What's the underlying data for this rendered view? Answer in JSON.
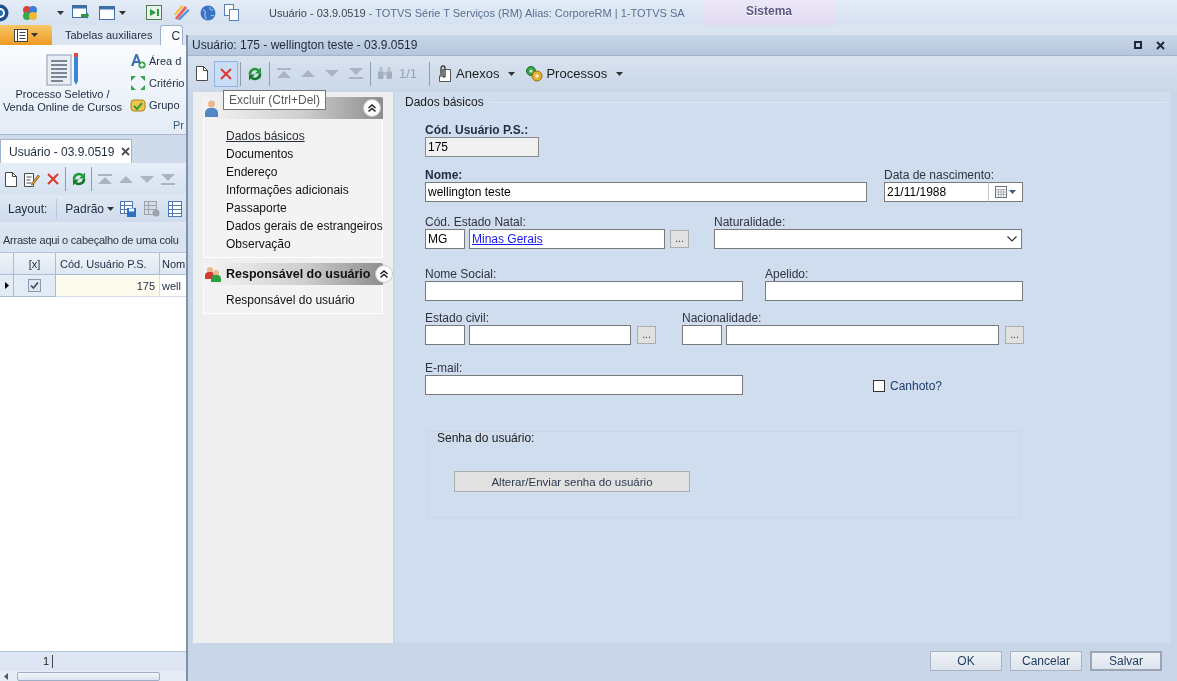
{
  "app": {
    "title": {
      "document": "Usuário - 03.9.0519",
      "application": "- TOTVS Série T Serviços (RM) Alias: CorporeRM | 1-TOTVS SA"
    },
    "context_tab": "Sistema",
    "ribbon_tabs": [
      {
        "label": "Tabelas auxiliares",
        "selected": false
      },
      {
        "label": "C",
        "selected": true
      }
    ],
    "ribbon": {
      "large_button": "Processo Seletivo / Venda Online de Cursos",
      "small_buttons": [
        {
          "kind": "area",
          "label": "Área d"
        },
        {
          "kind": "criteria",
          "label": "Critério"
        },
        {
          "kind": "group",
          "label": "Grupo"
        }
      ],
      "group_label": "Pr"
    },
    "document_tab": {
      "label": "Usuário - 03.9.0519"
    },
    "toolbar": [
      {
        "kind": "new",
        "disabled": false
      },
      {
        "kind": "edit",
        "disabled": false
      },
      {
        "kind": "delete",
        "disabled": false
      },
      {
        "kind": "separator"
      },
      {
        "kind": "refresh",
        "disabled": false
      },
      {
        "kind": "separator"
      },
      {
        "kind": "first",
        "disabled": true
      },
      {
        "kind": "previous",
        "disabled": true
      },
      {
        "kind": "next",
        "disabled": true
      },
      {
        "kind": "last",
        "disabled": true
      }
    ],
    "layout_bar": {
      "label": "Layout:",
      "preset": "Padrão",
      "tools": [
        {
          "kind": "save",
          "disabled": false
        },
        {
          "kind": "reset",
          "disabled": true
        },
        {
          "kind": "columns",
          "disabled": false
        }
      ]
    },
    "group_panel": "Arraste aqui o cabeçalho de uma colu",
    "grid": {
      "columns": [
        "[x]",
        "Cód. Usuário P.S.",
        "Nom"
      ],
      "rows": [
        {
          "selected": true,
          "cells": [
            {
              "kind": "checkbox",
              "checked": true
            },
            {
              "kind": "text",
              "text": "175"
            },
            {
              "kind": "text",
              "text": "well"
            }
          ]
        }
      ]
    },
    "footer": {
      "count": "1"
    }
  },
  "dialog": {
    "title": "Usuário: 175 - wellington teste - 03.9.0519",
    "toolbar": {
      "tools": [
        {
          "kind": "new",
          "disabled": false,
          "hovered": false
        },
        {
          "kind": "delete",
          "disabled": false,
          "hovered": true
        },
        {
          "kind": "separator"
        },
        {
          "kind": "refresh",
          "disabled": false,
          "hovered": false
        },
        {
          "kind": "separator"
        },
        {
          "kind": "first",
          "disabled": true,
          "hovered": false
        },
        {
          "kind": "previous",
          "disabled": true,
          "hovered": false
        },
        {
          "kind": "next",
          "disabled": true,
          "hovered": false
        },
        {
          "kind": "last",
          "disabled": true,
          "hovered": false
        },
        {
          "kind": "separator"
        },
        {
          "kind": "find",
          "disabled": true,
          "hovered": false
        }
      ],
      "record_position": {
        "text": "1/1",
        "disabled": true
      },
      "menus": [
        {
          "kind": "attachments",
          "label": "Anexos"
        },
        {
          "kind": "processes",
          "label": "Processos"
        }
      ]
    },
    "tooltip": "Excluir (Ctrl+Del)",
    "nav": [
      {
        "kind": "user",
        "expanded": true,
        "items": [
          {
            "label": "Dados básicos",
            "selected": true
          },
          {
            "label": "Documentos",
            "selected": false
          },
          {
            "label": "Endereço",
            "selected": false
          },
          {
            "label": "Informações adicionais",
            "selected": false
          },
          {
            "label": "Passaporte",
            "selected": false
          },
          {
            "label": "Dados gerais de estrangeiros",
            "selected": false
          },
          {
            "label": "Observação",
            "selected": false
          }
        ]
      },
      {
        "kind": "guardian",
        "title": "Responsável do usuário",
        "expanded": true,
        "items": [
          {
            "label": "Responsável do usuário",
            "selected": false
          }
        ]
      }
    ],
    "form": {
      "title": "Dados básicos",
      "user_code": {
        "label": "Cód. Usuário P.S.:",
        "value": "175",
        "required": true,
        "readonly": true
      },
      "name": {
        "label": "Nome:",
        "value": "wellington teste",
        "required": true
      },
      "birth_date": {
        "label": "Data de nascimento:",
        "value": "21/11/1988"
      },
      "birth_state": {
        "label": "Cód. Estado Natal:",
        "code": "MG",
        "name": "Minas Gerais",
        "lookup": "..."
      },
      "birthplace": {
        "label": "Naturalidade:"
      },
      "social_name": {
        "label": "Nome Social:"
      },
      "nickname": {
        "label": "Apelido:"
      },
      "marital_status": {
        "label": "Estado civil:",
        "lookup": "..."
      },
      "nationality": {
        "label": "Nacionalidade:",
        "lookup": "..."
      },
      "email": {
        "label": "E-mail:"
      },
      "left_handed": {
        "label": "Canhoto?",
        "checked": false
      },
      "password": {
        "title": "Senha do usuário:",
        "button": "Alterar/Enviar senha do usuário"
      }
    },
    "buttons": [
      {
        "label": "OK",
        "focused": false
      },
      {
        "label": "Cancelar",
        "focused": false
      },
      {
        "label": "Salvar",
        "focused": true
      }
    ]
  }
}
